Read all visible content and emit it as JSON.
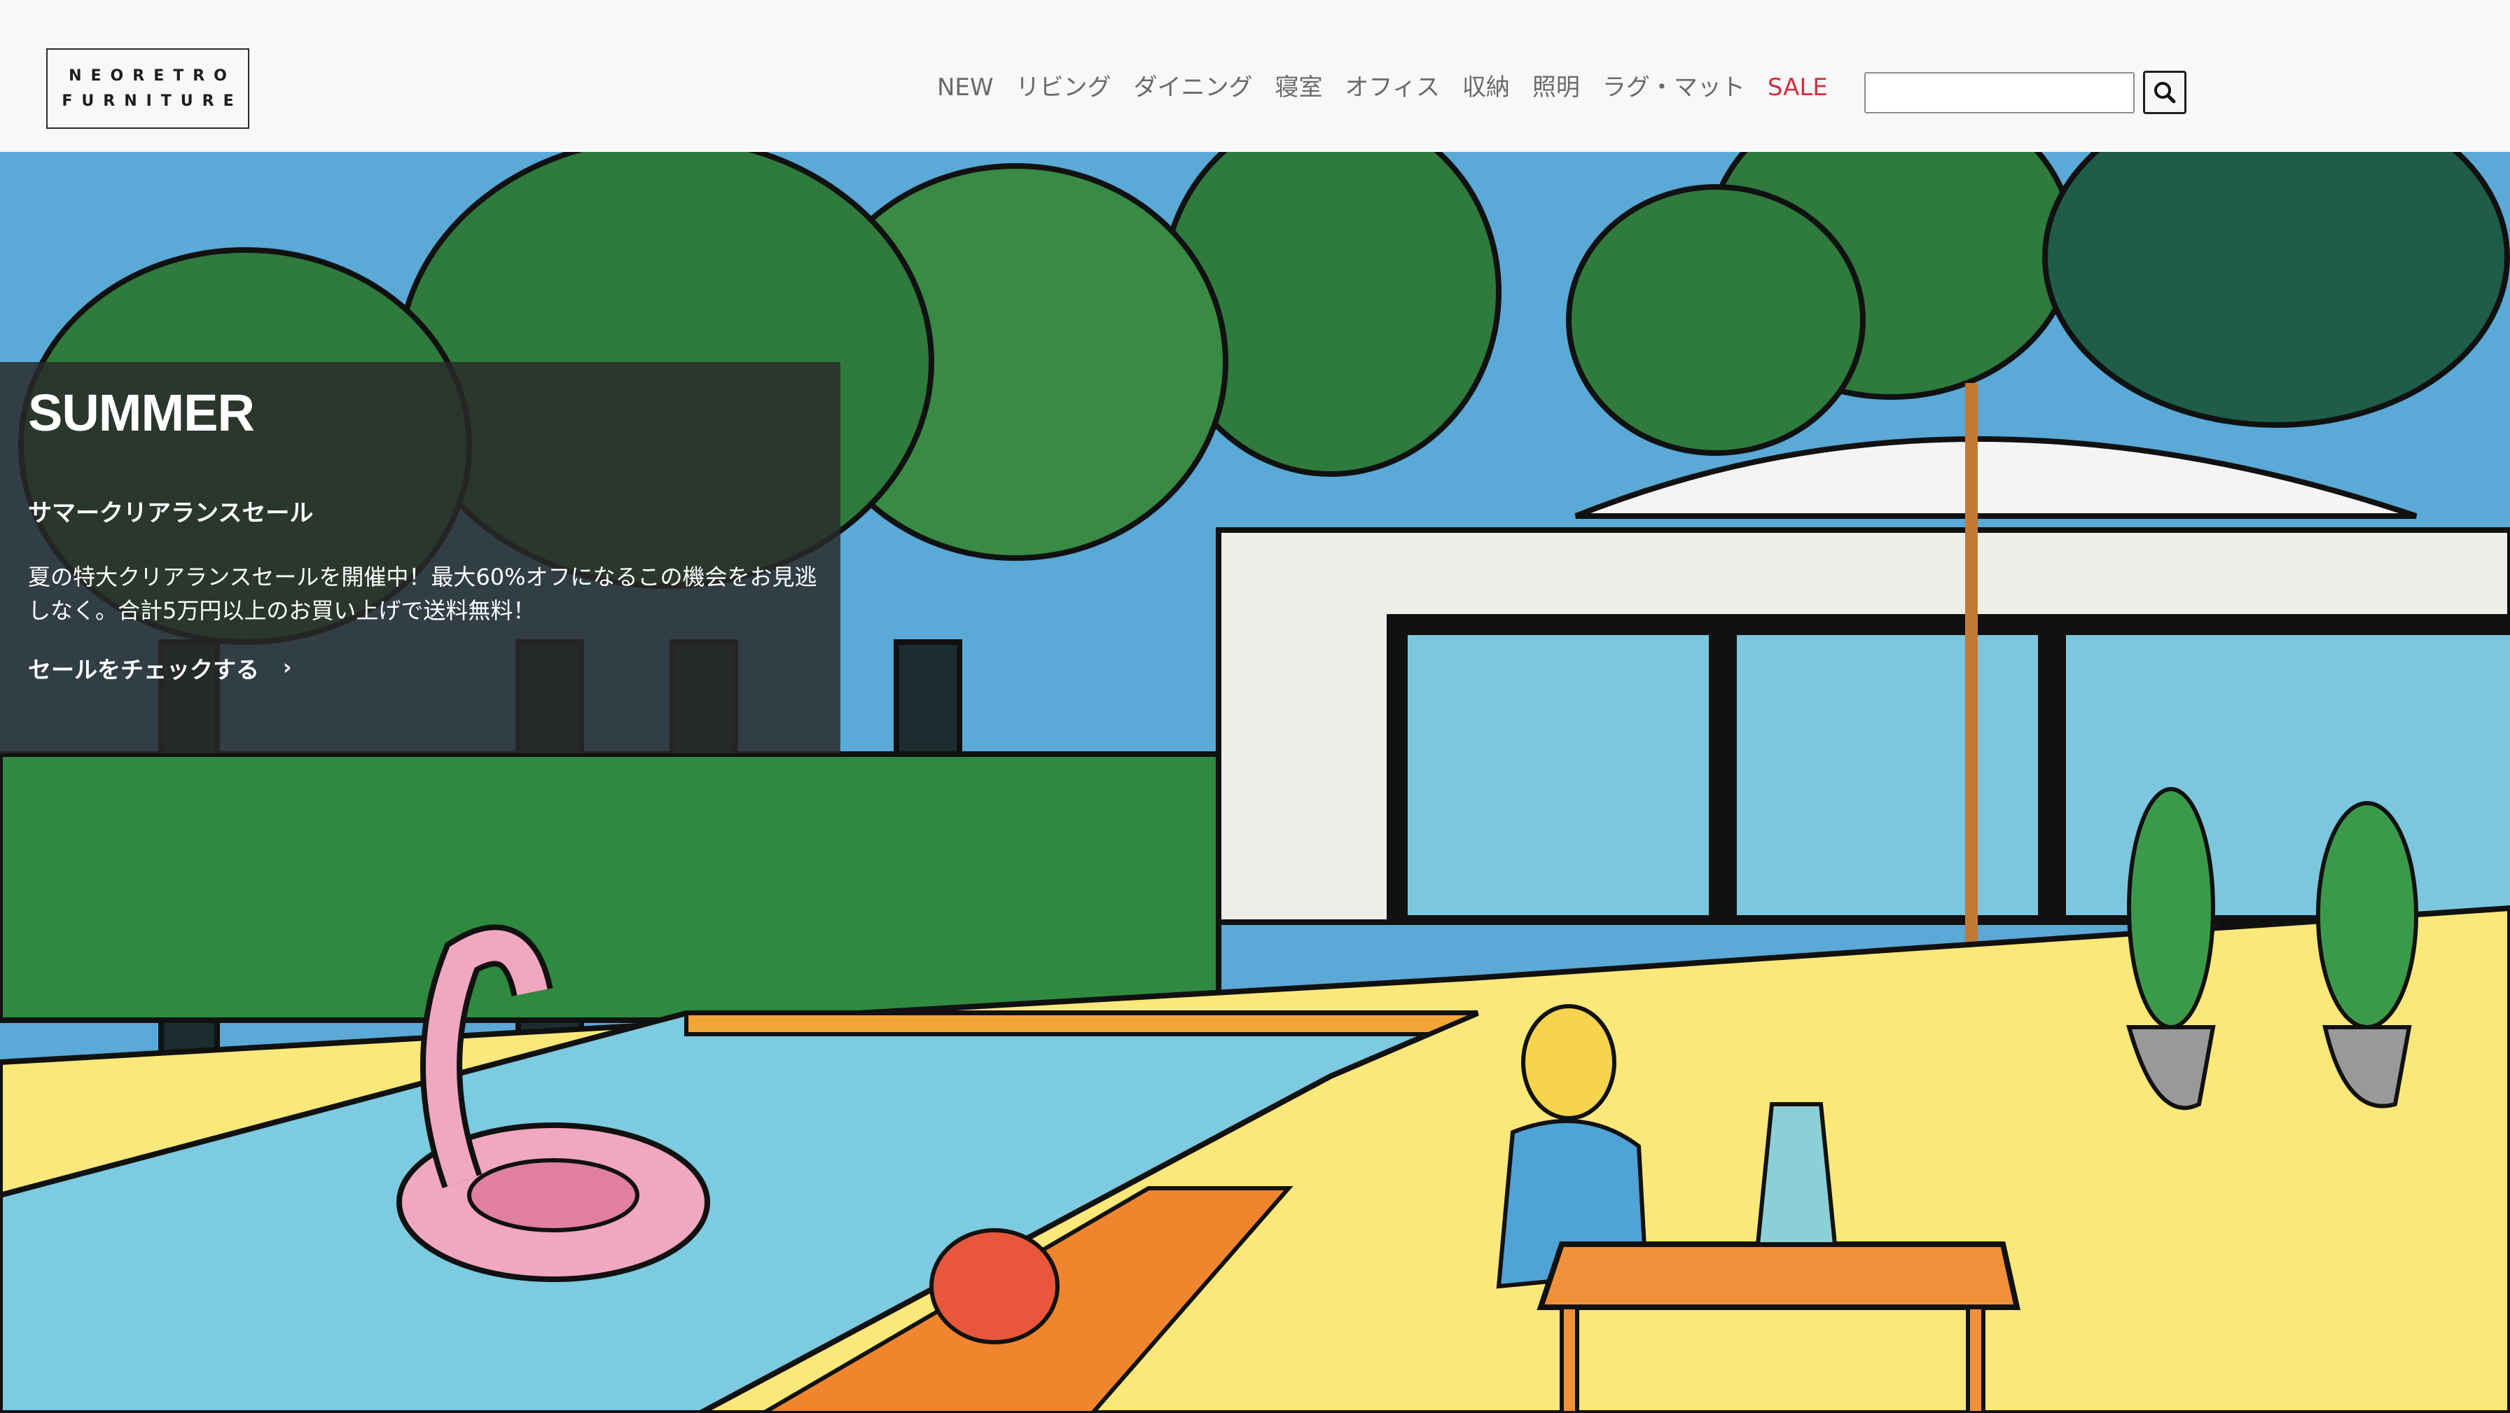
{
  "brand": {
    "line1": "NEORETRO",
    "line2": "FURNITURE"
  },
  "nav": [
    {
      "label": "NEW"
    },
    {
      "label": "リビング"
    },
    {
      "label": "ダイニング"
    },
    {
      "label": "寝室"
    },
    {
      "label": "オフィス"
    },
    {
      "label": "収納"
    },
    {
      "label": "照明"
    },
    {
      "label": "ラグ・マット"
    },
    {
      "label": "SALE"
    }
  ],
  "search": {
    "placeholder": "",
    "value": "",
    "icon": "search-icon"
  },
  "hero": {
    "title": "SUMMER",
    "subtitle": "サマークリアランスセール",
    "body": "夏の特大クリアランスセールを開催中！最大60%オフになるこの機会をお見逃しなく。合計5万円以上のお買い上げで送料無料！",
    "cta": "セールをチェックする",
    "cta_icon": "chevron-right-icon"
  },
  "colors": {
    "sale": "#d0313f",
    "nav": "#6a6a6a",
    "overlay": "#2a2a2a"
  }
}
